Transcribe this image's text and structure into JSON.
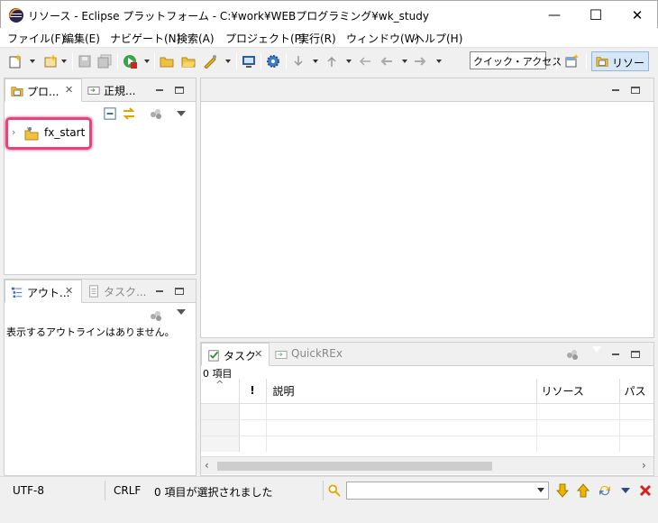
{
  "window": {
    "title": "リソース - Eclipse プラットフォーム - C:¥work¥WEBプログラミング¥wk_study",
    "minimize": "—",
    "maximize": "☐",
    "close": "✕"
  },
  "menu": [
    "ファイル(F)",
    "編集(E)",
    "ナビゲート(N)",
    "検索(A)",
    "プロジェクト(P)",
    "実行(R)",
    "ウィンドウ(W)",
    "ヘルプ(H)"
  ],
  "toolbar": {
    "quick_access": "クイック・アクセス",
    "perspective": "リソース"
  },
  "project_panel": {
    "tabs": [
      {
        "label": "プロ..."
      },
      {
        "label": "正規..."
      }
    ],
    "tree": [
      {
        "label": "fx_start",
        "expanded": false
      }
    ]
  },
  "outline_panel": {
    "tabs": [
      {
        "label": "アウト..."
      },
      {
        "label": "タスク..."
      }
    ],
    "message": "表示するアウトラインはありません。"
  },
  "tasks_panel": {
    "tabs": [
      {
        "label": "タスク"
      },
      {
        "label": "QuickREx"
      }
    ],
    "count": "0 項目",
    "columns": [
      "!",
      "説明",
      "リソース",
      "パス"
    ]
  },
  "status": {
    "encoding": "UTF-8",
    "line_endings": "CRLF",
    "selection": "0 項目が選択されました",
    "search_placeholder": ""
  },
  "colors": {
    "accent": "#e8417b",
    "perspective_bg": "#d5e6f7",
    "chrome": "#f0f0f0"
  }
}
